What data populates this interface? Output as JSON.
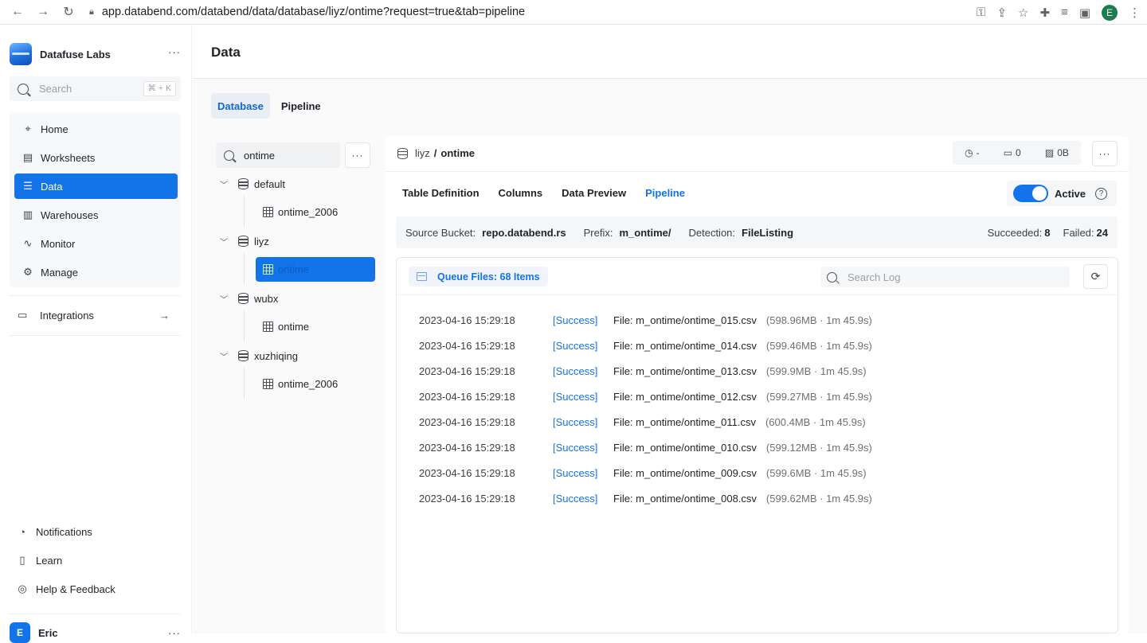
{
  "browser": {
    "url": "app.databend.com/databend/data/database/liyz/ontime?request=true&tab=pipeline",
    "profile_initial": "E"
  },
  "sidebar": {
    "org_name": "Datafuse Labs",
    "search_placeholder": "Search",
    "search_shortcut": "⌘ + K",
    "items": [
      {
        "label": "Home",
        "icon": "home-icon"
      },
      {
        "label": "Worksheets",
        "icon": "worksheet-icon"
      },
      {
        "label": "Data",
        "icon": "database-icon",
        "active": true
      },
      {
        "label": "Warehouses",
        "icon": "warehouse-icon"
      },
      {
        "label": "Monitor",
        "icon": "pulse-icon"
      },
      {
        "label": "Manage",
        "icon": "gear-icon"
      }
    ],
    "integrations": "Integrations",
    "bottom": [
      {
        "label": "Notifications",
        "icon": "bell-icon"
      },
      {
        "label": "Learn",
        "icon": "book-icon"
      },
      {
        "label": "Help & Feedback",
        "icon": "lifebuoy-icon"
      }
    ],
    "user_initial": "E",
    "user_name": "Eric"
  },
  "page": {
    "title": "Data",
    "tabs": [
      "Database",
      "Pipeline"
    ]
  },
  "tree": {
    "search_value": "ontime",
    "databases": [
      {
        "name": "default",
        "tables": [
          "ontime_2006"
        ]
      },
      {
        "name": "liyz",
        "tables": [
          "ontime"
        ]
      },
      {
        "name": "wubx",
        "tables": [
          "ontime"
        ]
      },
      {
        "name": "xuzhiqing",
        "tables": [
          "ontime_2006"
        ]
      }
    ]
  },
  "detail": {
    "database": "liyz",
    "table": "ontime",
    "stat_time": "-",
    "stat_rows": "0",
    "stat_size": "0B",
    "tabs": [
      "Table Definition",
      "Columns",
      "Data Preview",
      "Pipeline"
    ],
    "active_tab": "Pipeline",
    "toggle_label": "Active",
    "source_bucket_label": "Source Bucket:",
    "source_bucket": "repo.databend.rs",
    "prefix_label": "Prefix:",
    "prefix": "m_ontime/",
    "detection_label": "Detection:",
    "detection": "FileListing",
    "succeeded_label": "Succeeded:",
    "succeeded": "8",
    "failed_label": "Failed:",
    "failed": "24",
    "queue_label": "Queue Files: 68 Items",
    "log_search_placeholder": "Search Log",
    "logs": [
      {
        "time": "2023-04-16 15:29:18",
        "status": "[Success]",
        "file": "File: m_ontime/ontime_015.csv",
        "meta": "(598.96MB · 1m 45.9s)"
      },
      {
        "time": "2023-04-16 15:29:18",
        "status": "[Success]",
        "file": "File: m_ontime/ontime_014.csv",
        "meta": "(599.46MB · 1m 45.9s)"
      },
      {
        "time": "2023-04-16 15:29:18",
        "status": "[Success]",
        "file": "File: m_ontime/ontime_013.csv",
        "meta": "(599.9MB · 1m 45.9s)"
      },
      {
        "time": "2023-04-16 15:29:18",
        "status": "[Success]",
        "file": "File: m_ontime/ontime_012.csv",
        "meta": "(599.27MB · 1m 45.9s)"
      },
      {
        "time": "2023-04-16 15:29:18",
        "status": "[Success]",
        "file": "File: m_ontime/ontime_011.csv",
        "meta": "(600.4MB · 1m 45.9s)"
      },
      {
        "time": "2023-04-16 15:29:18",
        "status": "[Success]",
        "file": "File: m_ontime/ontime_010.csv",
        "meta": "(599.12MB · 1m 45.9s)"
      },
      {
        "time": "2023-04-16 15:29:18",
        "status": "[Success]",
        "file": "File: m_ontime/ontime_009.csv",
        "meta": "(599.6MB · 1m 45.9s)"
      },
      {
        "time": "2023-04-16 15:29:18",
        "status": "[Success]",
        "file": "File: m_ontime/ontime_008.csv",
        "meta": "(599.62MB · 1m 45.9s)"
      }
    ]
  },
  "colors": {
    "accent": "#1373e8"
  }
}
